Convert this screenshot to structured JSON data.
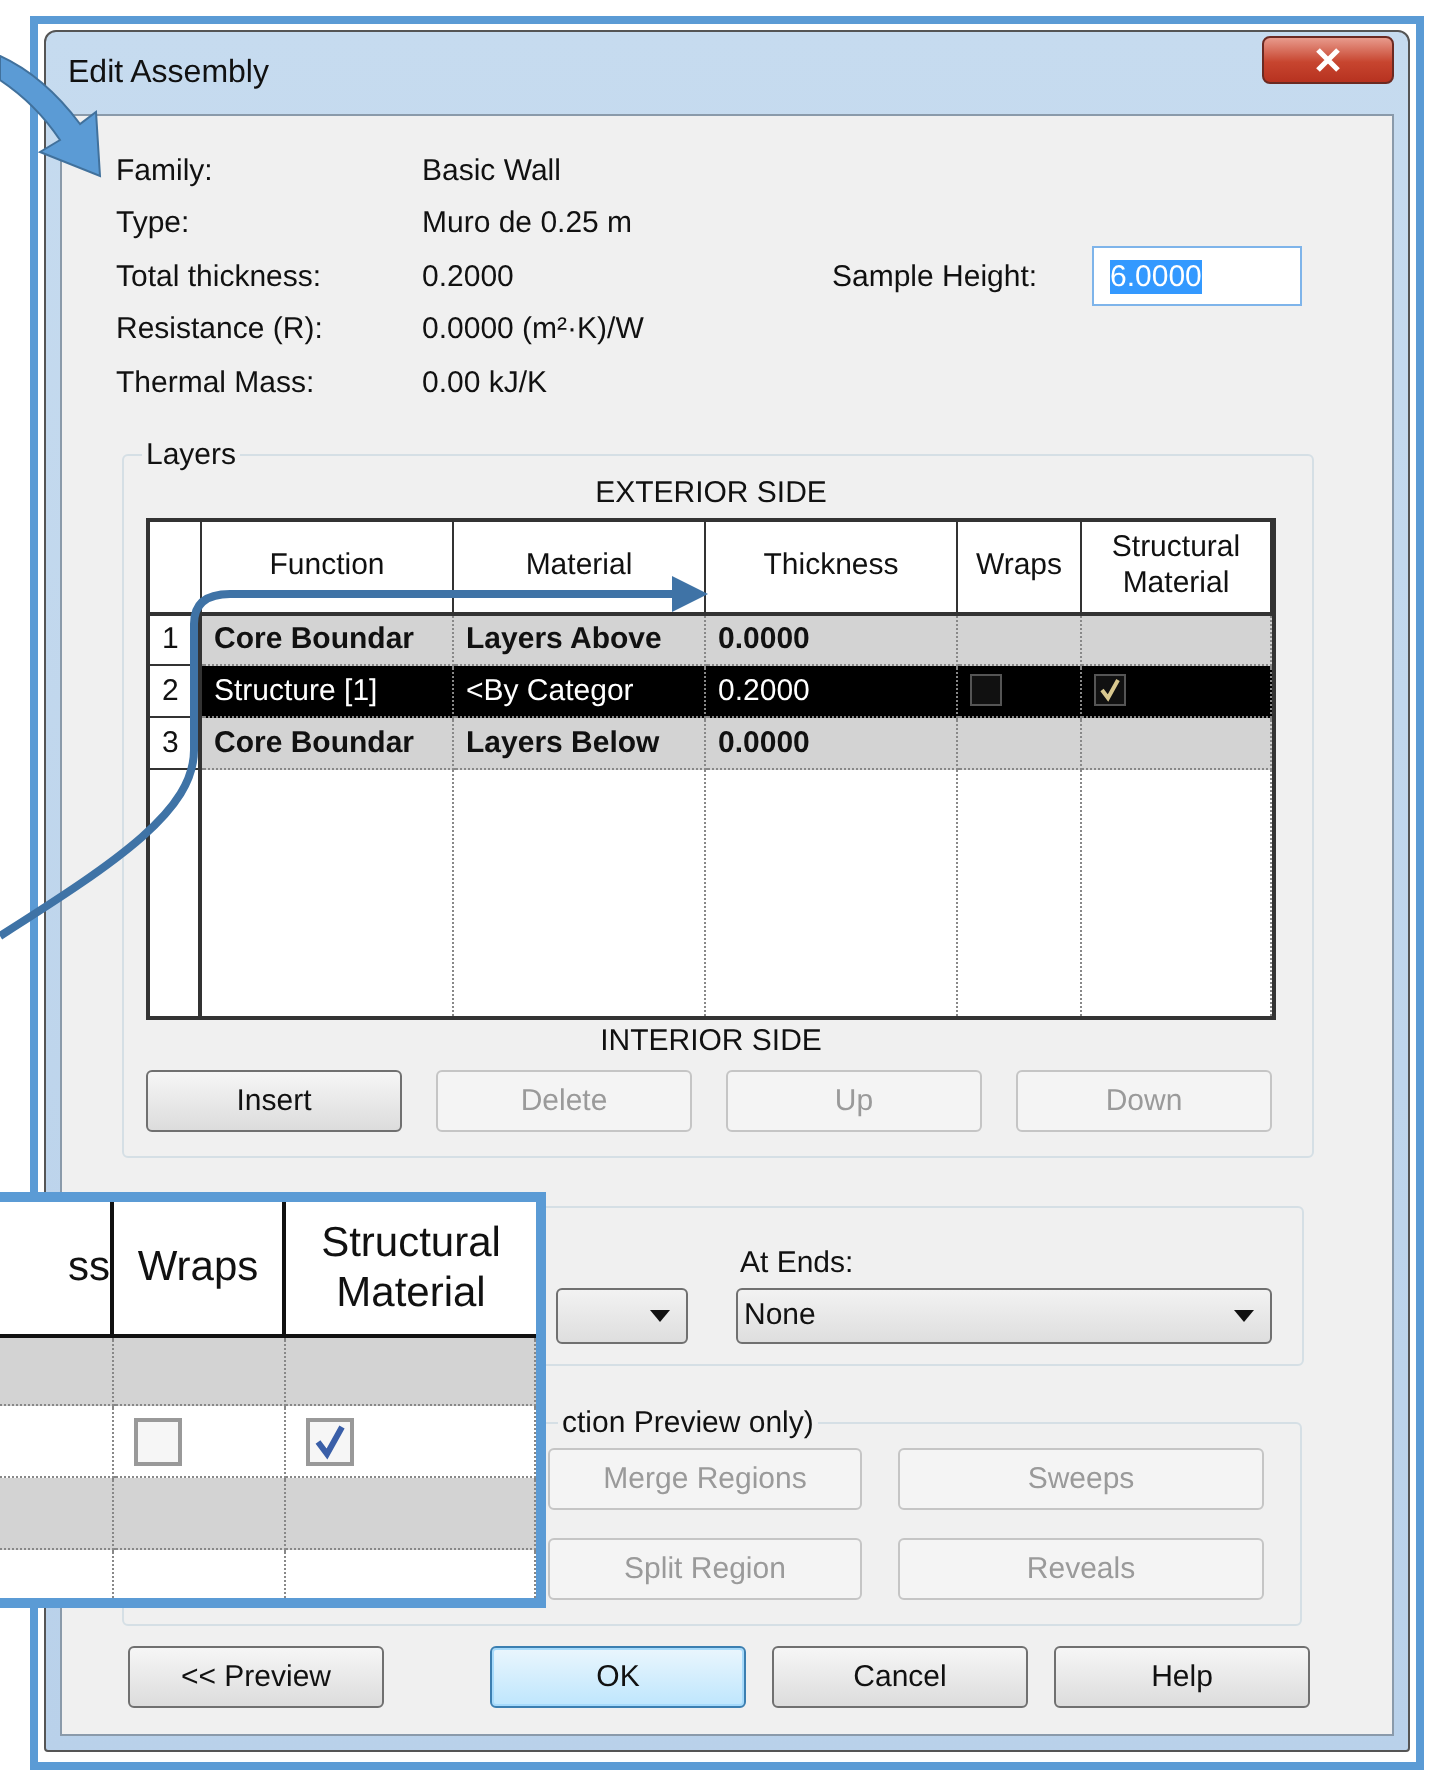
{
  "window": {
    "title": "Edit Assembly"
  },
  "properties": [
    {
      "label": "Family:",
      "value": "Basic Wall"
    },
    {
      "label": "Type:",
      "value": "Muro de 0.25 m"
    },
    {
      "label": "Total thickness:",
      "value": "0.2000"
    },
    {
      "label": "Resistance (R):",
      "value": "0.0000 (m²·K)/W"
    },
    {
      "label": "Thermal Mass:",
      "value": "0.00 kJ/K"
    }
  ],
  "sample_height": {
    "label": "Sample Height:",
    "value": "6.0000",
    "text_selected": true
  },
  "layers": {
    "title": "Layers",
    "exterior_label": "EXTERIOR SIDE",
    "interior_label": "INTERIOR SIDE",
    "columns": [
      "Function",
      "Material",
      "Thickness",
      "Wraps",
      "Structural Material"
    ],
    "rows": [
      {
        "number": "1",
        "kind": "boundary",
        "function": "Core Boundar",
        "material": "Layers Above",
        "thickness": "0.0000",
        "selected": false
      },
      {
        "number": "2",
        "kind": "layer",
        "function": "Structure [1]",
        "material": "<By Categor",
        "thickness": "0.2000",
        "wraps": false,
        "structural_material": true,
        "selected": true
      },
      {
        "number": "3",
        "kind": "boundary",
        "function": "Core Boundar",
        "material": "Layers Below",
        "thickness": "0.0000",
        "selected": false
      }
    ],
    "buttons": [
      {
        "label": "Insert",
        "disabled": false
      },
      {
        "label": "Delete",
        "disabled": true
      },
      {
        "label": "Up",
        "disabled": true
      },
      {
        "label": "Down",
        "disabled": true
      }
    ]
  },
  "default_wrapping": {
    "at_ends": {
      "label": "At Ends:",
      "value": "None"
    }
  },
  "modify": {
    "title": "ction Preview only)",
    "buttons": [
      {
        "label": "Merge Regions",
        "disabled": true
      },
      {
        "label": "Sweeps",
        "disabled": true
      },
      {
        "label": "Split Region",
        "disabled": true
      },
      {
        "label": "Reveals",
        "disabled": true
      }
    ]
  },
  "footer_buttons": [
    {
      "label": "<< Preview",
      "default": false
    },
    {
      "label": "OK",
      "default": true
    },
    {
      "label": "Cancel",
      "default": false
    },
    {
      "label": "Help",
      "default": false
    }
  ],
  "inset": {
    "columns": [
      "ss",
      "Wraps",
      "Structural Material"
    ],
    "rows": [
      {
        "kind": "boundary",
        "selected": false
      },
      {
        "kind": "layer",
        "selected": false,
        "wraps": false,
        "structural_material": true
      },
      {
        "kind": "boundary",
        "selected": false
      }
    ]
  }
}
